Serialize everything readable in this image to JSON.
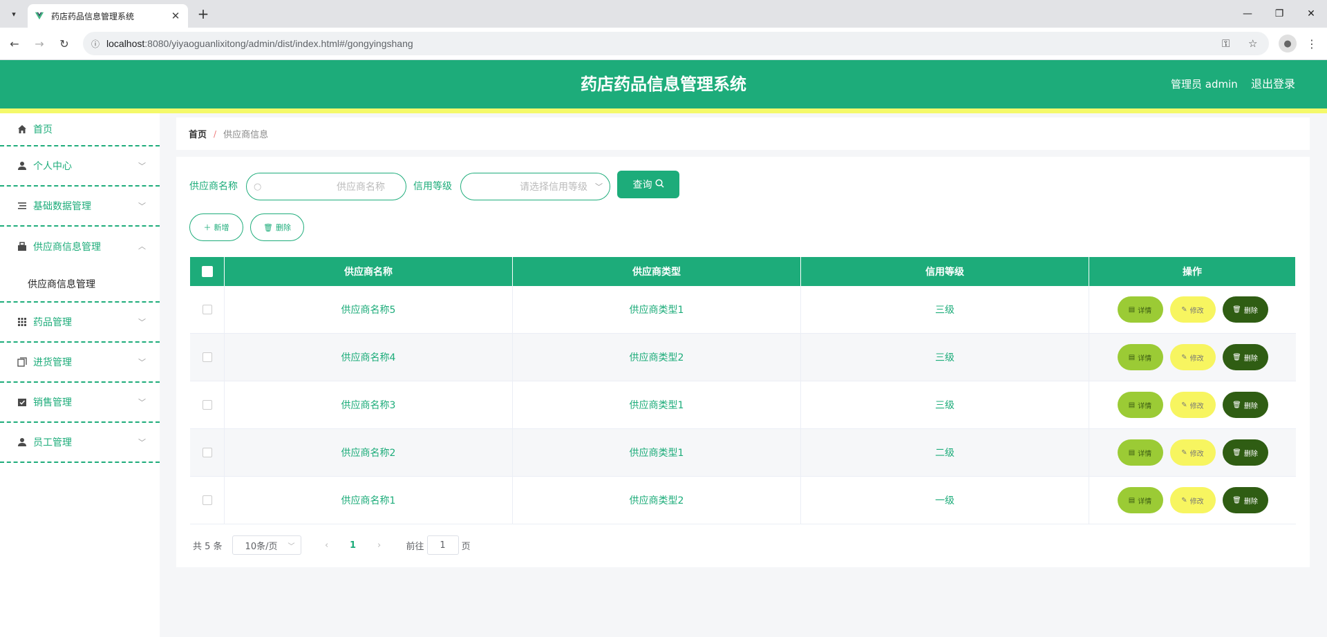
{
  "browser": {
    "tab_title": "药店药品信息管理系统",
    "url_host": "localhost",
    "url_rest": ":8080/yiyaoguanlixitong/admin/dist/index.html#/gongyingshang"
  },
  "header": {
    "title": "药店药品信息管理系统",
    "admin_label": "管理员 admin",
    "logout_label": "退出登录"
  },
  "colors": {
    "primary": "#1dac7a",
    "accent_strip": "#f4f96a",
    "detail_btn": "#9bcb35",
    "edit_btn": "#f7f560",
    "delete_btn": "#2f5d13"
  },
  "sidebar": {
    "items": [
      {
        "label": "首页",
        "icon": "home-icon"
      },
      {
        "label": "个人中心",
        "icon": "user-icon"
      },
      {
        "label": "基础数据管理",
        "icon": "list-icon"
      },
      {
        "label": "供应商信息管理",
        "icon": "supplier-icon"
      },
      {
        "label": "药品管理",
        "icon": "grid-icon"
      },
      {
        "label": "进货管理",
        "icon": "copy-icon"
      },
      {
        "label": "销售管理",
        "icon": "checklist-icon"
      },
      {
        "label": "员工管理",
        "icon": "user-icon"
      }
    ],
    "submenu_label": "供应商信息管理"
  },
  "breadcrumb": {
    "home": "首页",
    "separator": "/",
    "current": "供应商信息"
  },
  "search": {
    "name_label": "供应商名称",
    "name_placeholder": "供应商名称",
    "level_label": "信用等级",
    "level_placeholder": "请选择信用等级",
    "button_label": "查询"
  },
  "actions": {
    "add_label": "新增",
    "delete_label": "删除"
  },
  "table": {
    "columns": [
      "供应商名称",
      "供应商类型",
      "信用等级",
      "操作"
    ],
    "rows": [
      {
        "name": "供应商名称5",
        "type": "供应商类型1",
        "level": "三级"
      },
      {
        "name": "供应商名称4",
        "type": "供应商类型2",
        "level": "三级"
      },
      {
        "name": "供应商名称3",
        "type": "供应商类型1",
        "level": "三级"
      },
      {
        "name": "供应商名称2",
        "type": "供应商类型1",
        "level": "二级"
      },
      {
        "name": "供应商名称1",
        "type": "供应商类型2",
        "level": "一级"
      }
    ],
    "op_labels": {
      "detail": "详情",
      "edit": "修改",
      "delete": "删除"
    }
  },
  "pagination": {
    "total_text": "共 5 条",
    "page_size": "10条/页",
    "current_page": "1",
    "goto_label": "前往",
    "goto_value": "1",
    "page_suffix": "页"
  }
}
